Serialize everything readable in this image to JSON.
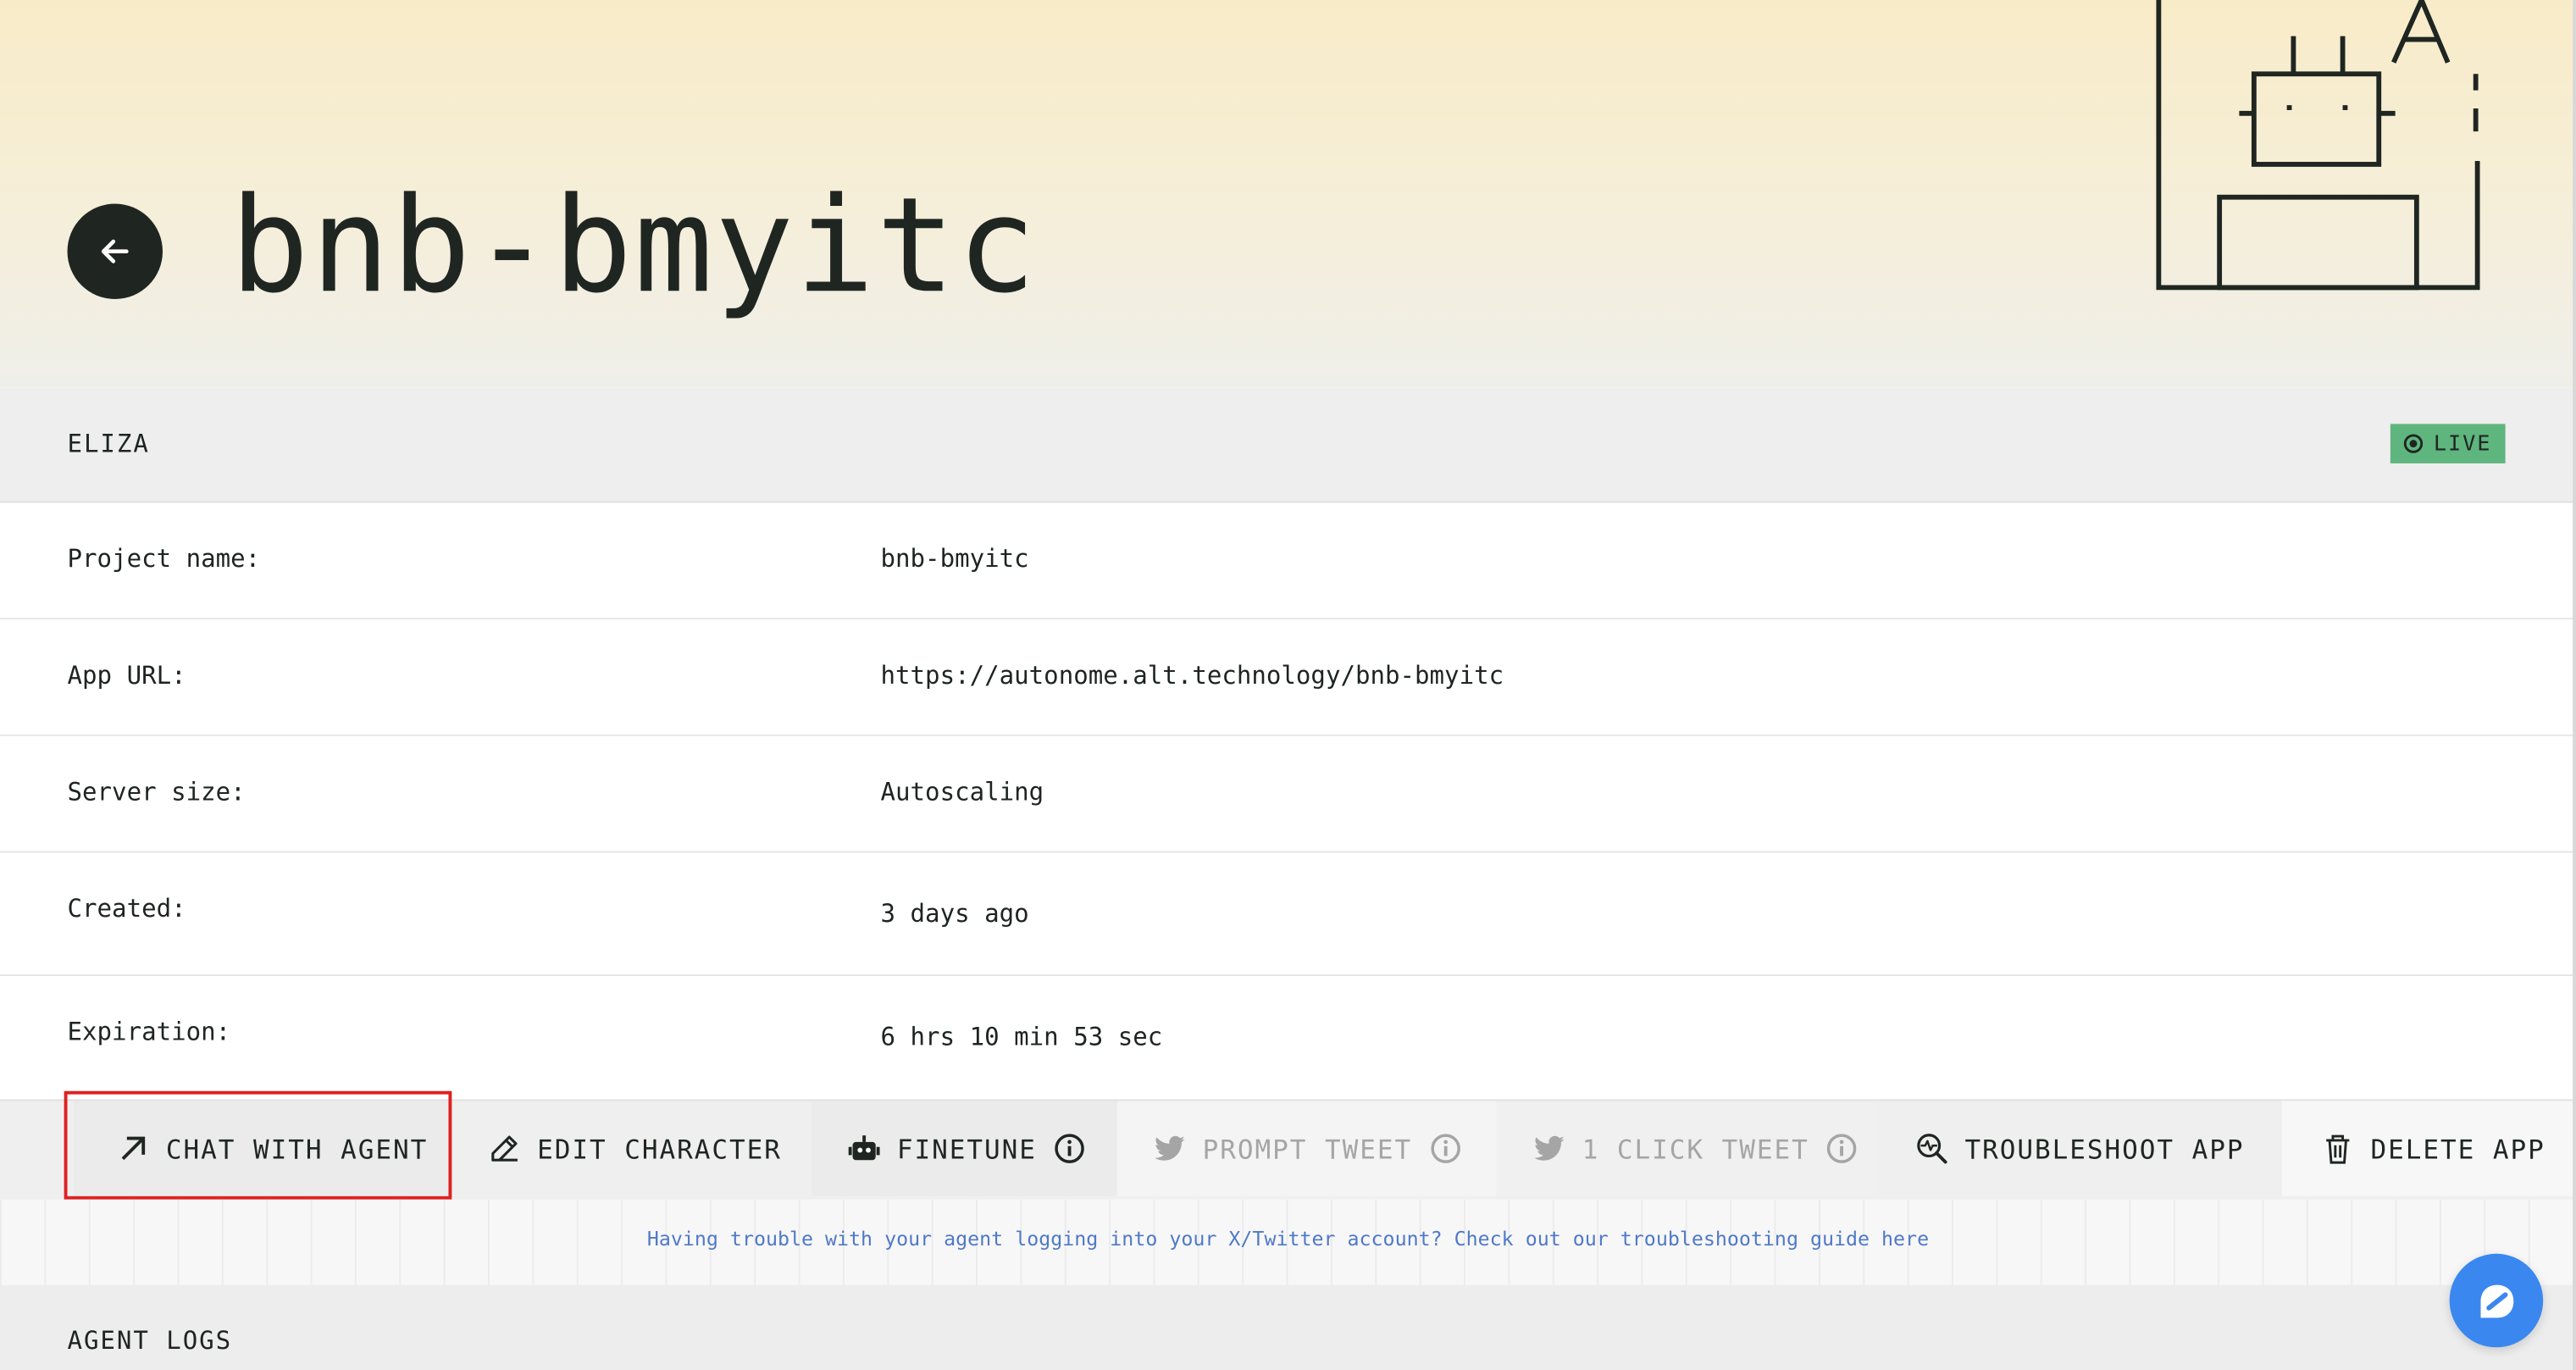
{
  "header": {
    "title": "bnb-bmyitc"
  },
  "section": {
    "label": "ELIZA",
    "status": "LIVE",
    "status_color": "#5fb57e"
  },
  "details": [
    {
      "key": "Project name:",
      "value": "bnb-bmyitc"
    },
    {
      "key": "App URL:",
      "value": "https://autonome.alt.technology/bnb-bmyitc"
    },
    {
      "key": "Server size:",
      "value": "Autoscaling"
    },
    {
      "key": "Created:",
      "value": "3 days ago"
    },
    {
      "key": "Expiration:",
      "value": "6 hrs 10 min 53 sec"
    }
  ],
  "actions": {
    "chat": "CHAT WITH AGENT",
    "edit": "EDIT CHARACTER",
    "finetune": "FINETUNE",
    "prompt_tweet": "PROMPT TWEET",
    "one_click_tweet": "1 CLICK TWEET",
    "troubleshoot": "TROUBLESHOOT APP",
    "delete": "DELETE APP"
  },
  "notice": {
    "text": "Having trouble with your agent logging into your X/Twitter account? Check out our troubleshooting guide here"
  },
  "logs": {
    "label": "AGENT LOGS"
  },
  "colors": {
    "hero_top": "#f8ecc8",
    "dark": "#1f2622",
    "link": "#4f79c8",
    "highlight": "#e02020",
    "fab": "#3b87f0"
  },
  "icons": {
    "back": "arrow-left-icon",
    "chat": "arrow-up-right-icon",
    "edit": "pencil-icon",
    "finetune": "robot-icon",
    "twitter": "twitter-bird-icon",
    "info": "info-icon",
    "troubleshoot": "search-pulse-icon",
    "delete": "trash-icon",
    "fab": "chat-bubble-icon"
  }
}
